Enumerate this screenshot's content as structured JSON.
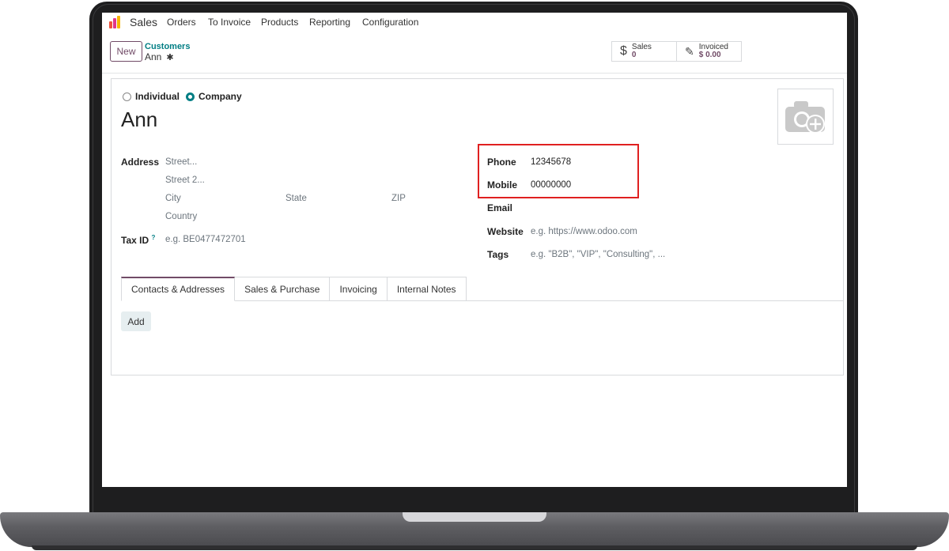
{
  "nav": {
    "app_name": "Sales",
    "menu": [
      "Orders",
      "To Invoice",
      "Products",
      "Reporting",
      "Configuration"
    ]
  },
  "control": {
    "new_label": "New",
    "breadcrumb_parent": "Customers",
    "breadcrumb_current": "Ann",
    "stats": [
      {
        "label": "Sales",
        "value": "0",
        "icon": "dollar-icon"
      },
      {
        "label": "Invoiced",
        "value": "$ 0.00",
        "icon": "edit-invoice-icon"
      }
    ]
  },
  "form": {
    "company_type": {
      "individual": "Individual",
      "company": "Company",
      "selected": "Company"
    },
    "name": "Ann",
    "address_label": "Address",
    "street_ph": "Street...",
    "street2_ph": "Street 2...",
    "city_ph": "City",
    "state_ph": "State",
    "zip_ph": "ZIP",
    "country_ph": "Country",
    "taxid_label": "Tax ID",
    "taxid_help": "?",
    "taxid_ph": "e.g. BE0477472701",
    "phone_label": "Phone",
    "phone_value": "12345678",
    "mobile_label": "Mobile",
    "mobile_value": "00000000",
    "email_label": "Email",
    "website_label": "Website",
    "website_ph": "e.g. https://www.odoo.com",
    "tags_label": "Tags",
    "tags_ph": "e.g. \"B2B\", \"VIP\", \"Consulting\", ..."
  },
  "notebook": {
    "tabs": [
      "Contacts & Addresses",
      "Sales & Purchase",
      "Invoicing",
      "Internal Notes"
    ],
    "active": "Contacts & Addresses",
    "add_label": "Add"
  },
  "colors": {
    "brand": "#714b67",
    "accent": "#017e84",
    "highlight": "#e02020"
  }
}
